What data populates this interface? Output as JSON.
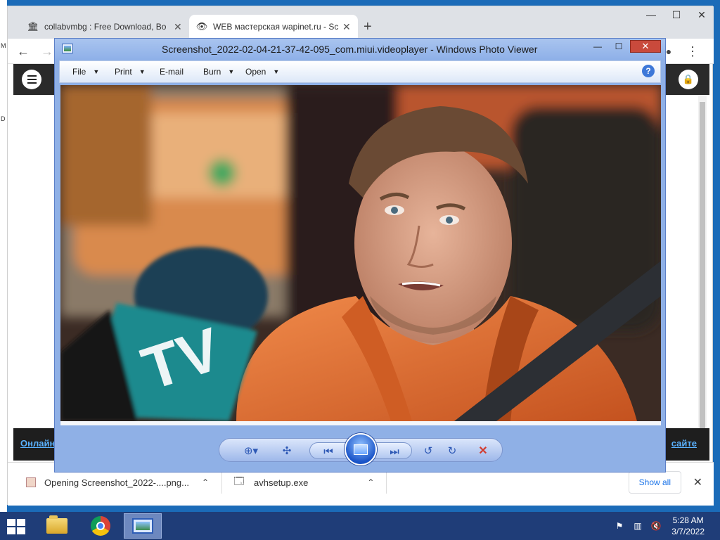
{
  "browser": {
    "tabs": [
      {
        "title": "collabvmbg : Free Download, Bo",
        "icon": "archive-icon"
      },
      {
        "title": "WEB мастерская wapinet.ru - Sc",
        "icon": "eye-icon"
      }
    ],
    "new_tab": "+",
    "window_controls": {
      "minimize": "—",
      "maximize": "☐",
      "close": "✕"
    },
    "toolbar": {
      "back": "←",
      "forward": "→",
      "menu": "⋮",
      "profile": "profile-icon"
    },
    "site": {
      "footer_left": "Онлайн",
      "footer_right": "сайте"
    },
    "downloads": [
      {
        "label": "Opening Screenshot_2022-....png...",
        "chevron": "⌃"
      },
      {
        "label": "avhsetup.exe",
        "chevron": "⌃"
      }
    ],
    "show_all": "Show all",
    "close_downloads": "✕"
  },
  "photo_viewer": {
    "title": "Screenshot_2022-02-04-21-37-42-095_com.miui.videoplayer - Windows Photo Viewer",
    "controls": {
      "minimize": "—",
      "maximize": "☐",
      "close": "✕"
    },
    "menu": [
      {
        "label": "File",
        "has_dropdown": true
      },
      {
        "label": "Print",
        "has_dropdown": true
      },
      {
        "label": "E-mail",
        "has_dropdown": false
      },
      {
        "label": "Burn",
        "has_dropdown": true
      },
      {
        "label": "Open",
        "has_dropdown": true
      }
    ],
    "help": "?",
    "image_overlay_text": "TV",
    "control_bar": {
      "zoom": "⊕▾",
      "actual_size": "✣",
      "previous": "⏮",
      "next": "⏭",
      "rotate_ccw": "↺",
      "rotate_cw": "↻",
      "delete": "✕"
    }
  },
  "taskbar": {
    "apps": [
      "file-explorer-icon",
      "chrome-icon",
      "photo-viewer-icon"
    ],
    "tray": [
      "flag-icon",
      "network-icon",
      "volume-muted-icon"
    ],
    "time": "5:28 AM",
    "date": "3/7/2022"
  },
  "colors": {
    "desktop": "#1b6bb8",
    "taskbar": "#1f3d78",
    "viewer_frame": "#8fb0e6",
    "close_red": "#c94a3c",
    "jacket_orange": "#e0652a",
    "mic_teal": "#1b8a8e",
    "link_blue": "#5ab2ff"
  }
}
